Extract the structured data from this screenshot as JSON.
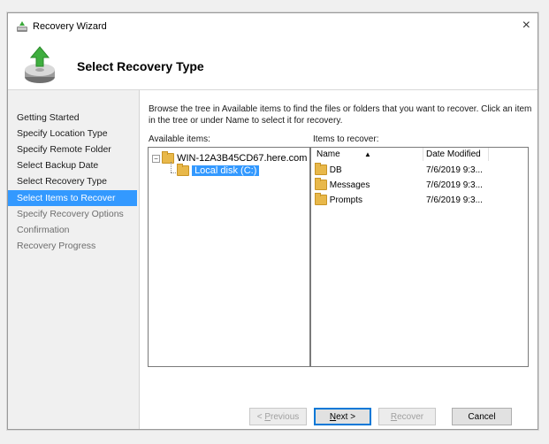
{
  "window": {
    "title": "Recovery Wizard",
    "close_glyph": "×",
    "icon": "recovery-wizard-icon"
  },
  "header": {
    "heading": "Select Recovery Type",
    "icon": "recovery-disk-icon"
  },
  "nav": {
    "items": [
      {
        "label": "Getting Started",
        "state": "done"
      },
      {
        "label": "Specify Location Type",
        "state": "done"
      },
      {
        "label": "Specify Remote Folder",
        "state": "done"
      },
      {
        "label": "Select Backup Date",
        "state": "done"
      },
      {
        "label": "Select Recovery Type",
        "state": "done"
      },
      {
        "label": "Select Items to Recover",
        "state": "active"
      },
      {
        "label": "Specify Recovery Options",
        "state": "pending"
      },
      {
        "label": "Confirmation",
        "state": "pending"
      },
      {
        "label": "Recovery Progress",
        "state": "pending"
      }
    ]
  },
  "content": {
    "instructions": "Browse the tree in Available items to find the files or folders that you want to recover. Click an item in the tree or under Name to select it for recovery.",
    "available_label": "Available items:",
    "recover_label": "Items to recover:",
    "tree": {
      "expander": "−",
      "root": "WIN-12A3B45CD67.here.com",
      "child": "Local disk (C:)"
    },
    "list": {
      "columns": {
        "name": "Name",
        "date": "Date Modified",
        "sort_glyph": "▲"
      },
      "rows": [
        {
          "name": "DB",
          "date": "7/6/2019 9:3..."
        },
        {
          "name": "Messages",
          "date": "7/6/2019 9:3..."
        },
        {
          "name": "Prompts",
          "date": "7/6/2019 9:3..."
        }
      ]
    }
  },
  "buttons": {
    "previous_prefix": "< ",
    "previous_u": "P",
    "previous_rest": "revious",
    "next_u": "N",
    "next_rest": "ext >",
    "recover_u": "R",
    "recover_rest": "ecover",
    "cancel": "Cancel"
  },
  "colors": {
    "selection": "#3399ff",
    "accent": "#0078d7",
    "folder": "#e8b84a"
  }
}
